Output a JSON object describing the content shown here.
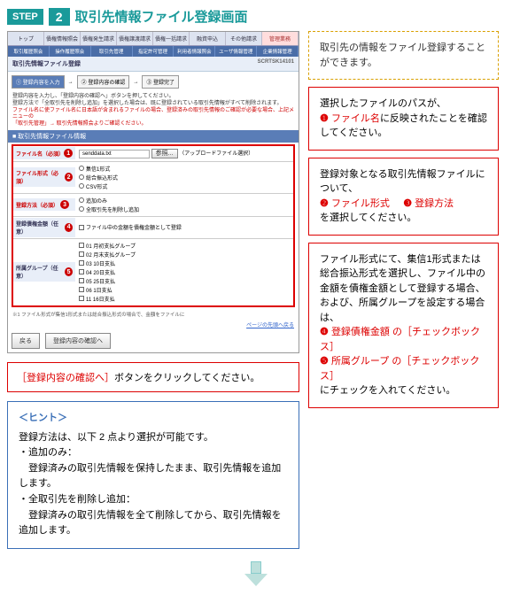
{
  "step": {
    "label": "STEP",
    "num": "2",
    "title": "取引先情報ファイル登録画面"
  },
  "tabs": [
    "トップ",
    "債権情報照会",
    "債権発生請求",
    "債権譲渡請求",
    "債権一括請求",
    "融資申込",
    "その他請求",
    "管理業務"
  ],
  "subtabs": [
    "取引履歴照会",
    "操作履歴照会",
    "取引先管理",
    "指定許可管理",
    "利用者情報照会",
    "ユーザ情報管理",
    "企業情報管理"
  ],
  "section": {
    "head": "取引先情報ファイル登録",
    "sortkey": "SCRTSK14101"
  },
  "flow": {
    "s1": "① 登録内容を入力",
    "s2": "② 登録内容の確認",
    "s3": "③ 登録完了"
  },
  "desc": {
    "l1": "登録内容を入力し、「登録内容の確認へ」ボタンを押してください。",
    "l2": "登録方法で「全取引先を削除し追加」を選択した場合は、既に登録されている取引先情報がすべて削除されます。",
    "l3": "ファイル名に使ファイル名に日本語が含まれるファイルの場合、登録済みの取引先情報のご確認が必要な場合、上記メニューの",
    "l4": "「取引先管理」→ 取引先情報照会よりご確認ください。"
  },
  "panel": "■ 取引先情報ファイル情報",
  "form": {
    "r1": {
      "label": "ファイル名（必須）",
      "val": "senddata.txt",
      "btn": "参照...",
      "hint": "（アップロードファイル選択）"
    },
    "r2": {
      "label": "ファイル形式（必須）",
      "o1": "集信1形式",
      "o2": "総合振込形式",
      "o3": "CSV形式"
    },
    "r3": {
      "label": "登録方法（必須）",
      "o1": "追加のみ",
      "o2": "全取引先を削除し追加"
    },
    "r4": {
      "label": "登録債権金額（任意）",
      "c1": "ファイル中の金額を債権金額として登録"
    },
    "r5": {
      "label": "所属グループ（任意）",
      "g1": "01 月初支払グループ",
      "g2": "02 月末支払グループ",
      "g3": "03 10日支払",
      "g4": "04 20日支払",
      "g5": "05 25日支払",
      "g6": "06 1日支払",
      "g7": "11 16日支払"
    }
  },
  "smallnote": "※1 ファイル形式が集信1形式または総合振込形式の場合で、金額をファイルに",
  "buttons": {
    "back": "戻る",
    "confirm": "登録内容の確認へ"
  },
  "pagefoot": "ページの先頭へ戻る",
  "right": {
    "box1": "取引先の情報をファイル登録することができます。",
    "box2": {
      "l1": "選択したファイルのパスが、",
      "b1": "❶",
      "t1": "ファイル名",
      "l2": "に反映されたことを確認してください。"
    },
    "box3": {
      "l1": "登録対象となる取引先情報ファイルについて、",
      "b2": "❷",
      "t2": "ファイル形式",
      "b3": "❸",
      "t3": "登録方法",
      "l2": "を選択してください。"
    },
    "box4": {
      "l1": "ファイル形式にて、集信1形式または総合振込形式を選択し、ファイル中の金額を債権金額として登録する場合、および、所属グループを設定する場合は、",
      "b4": "❹",
      "t4": "登録債権金額",
      "c1": "の［チェックボックス］",
      "b5": "❺",
      "t5": "所属グループ",
      "c2": "の［チェックボックス］",
      "l2": "にチェックを入れてください。"
    }
  },
  "callout": {
    "t": "［登録内容の確認へ］",
    "rest": "ボタンをクリックしてください。"
  },
  "hint": {
    "title": "＜ヒント＞",
    "lead": "登録方法は、以下 2 点より選択が可能です。",
    "i1t": "・追加のみ：",
    "i1b": "　登録済みの取引先情報を保持したまま、取引先情報を追加します。",
    "i2t": "・全取引先を削除し追加：",
    "i2b": "　登録済みの取引先情報を全て削除してから、取引先情報を追加します。"
  }
}
